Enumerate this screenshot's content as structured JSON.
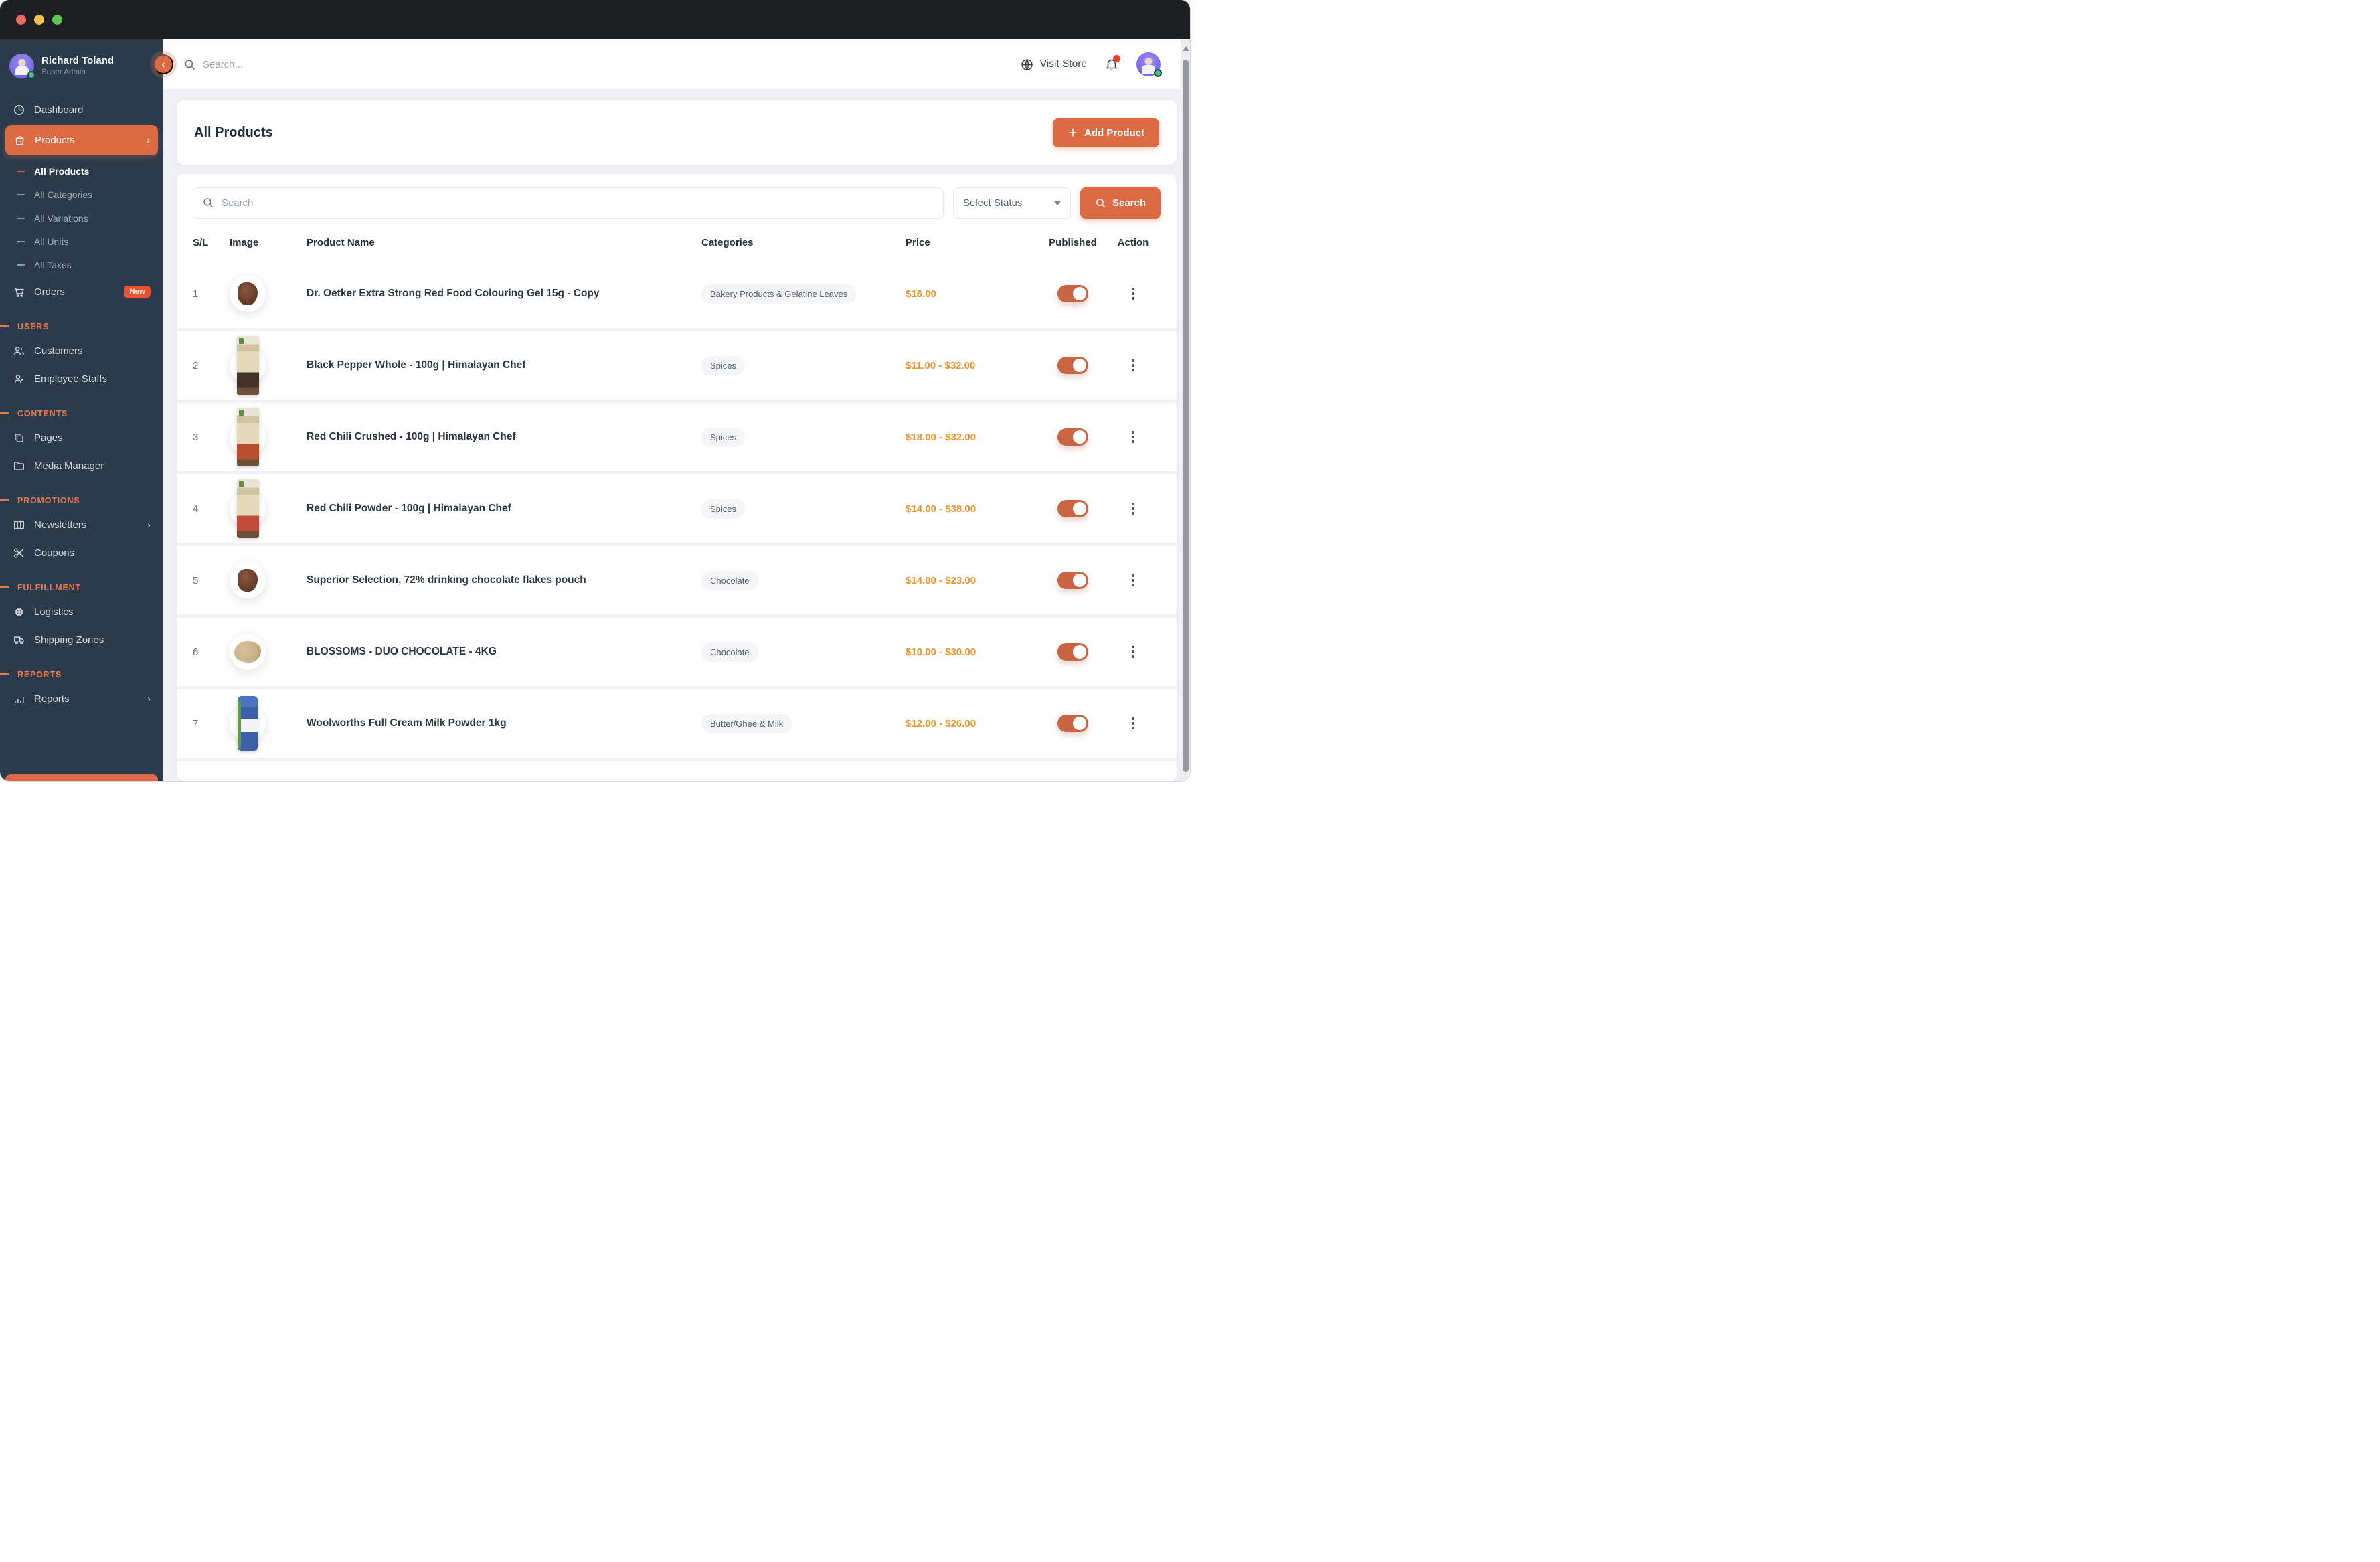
{
  "colors": {
    "accent": "#DC6A43",
    "price": "#F0932C",
    "sidebar": "#2B3B4C",
    "badge": "#E8502E"
  },
  "sidebar": {
    "user": {
      "name": "Richard Toland",
      "role": "Super Admin"
    },
    "nav": {
      "dashboard": "Dashboard",
      "products": "Products",
      "orders": "Orders",
      "orders_badge": "New",
      "customers": "Customers",
      "employee_staffs": "Employee Staffs",
      "pages": "Pages",
      "media_manager": "Media Manager",
      "newsletters": "Newsletters",
      "coupons": "Coupons",
      "logistics": "Logistics",
      "shipping_zones": "Shipping Zones",
      "reports": "Reports"
    },
    "submenu": [
      "All Products",
      "All Categories",
      "All Variations",
      "All Units",
      "All Taxes"
    ],
    "sections": {
      "users": "USERS",
      "contents": "CONTENTS",
      "promotions": "PROMOTIONS",
      "fulfillment": "FULFILLMENT",
      "reports": "REPORTS"
    }
  },
  "topbar": {
    "search_placeholder": "Search...",
    "visit_store": "Visit Store"
  },
  "header_card": {
    "title": "All Products",
    "add_button": "Add Product"
  },
  "filters": {
    "search_placeholder": "Search",
    "status_select": "Select Status",
    "search_button": "Search"
  },
  "table": {
    "headers": [
      "S/L",
      "Image",
      "Product Name",
      "Categories",
      "Price",
      "Published",
      "Action"
    ],
    "rows": [
      {
        "sl": "1",
        "name": "Dr. Oetker Extra Strong Red Food Colouring Gel 15g - Copy",
        "category": "Bakery Products & Gelatine Leaves",
        "price": "$16.00",
        "published": true
      },
      {
        "sl": "2",
        "name": "Black Pepper Whole - 100g | Himalayan Chef",
        "category": "Spices",
        "price": "$11.00 - $32.00",
        "published": true
      },
      {
        "sl": "3",
        "name": "Red Chili Crushed - 100g | Himalayan Chef",
        "category": "Spices",
        "price": "$18.00 - $32.00",
        "published": true
      },
      {
        "sl": "4",
        "name": "Red Chili Powder - 100g | Himalayan Chef",
        "category": "Spices",
        "price": "$14.00 - $38.00",
        "published": true
      },
      {
        "sl": "5",
        "name": "Superior Selection, 72% drinking chocolate flakes pouch",
        "category": "Chocolate",
        "price": "$14.00 - $23.00",
        "published": true
      },
      {
        "sl": "6",
        "name": "BLOSSOMS - DUO CHOCOLATE - 4KG",
        "category": "Chocolate",
        "price": "$10.00 - $30.00",
        "published": true
      },
      {
        "sl": "7",
        "name": "Woolworths Full Cream Milk Powder 1kg",
        "category": "Butter/Ghee & Milk",
        "price": "$12.00 - $26.00",
        "published": true
      }
    ]
  }
}
